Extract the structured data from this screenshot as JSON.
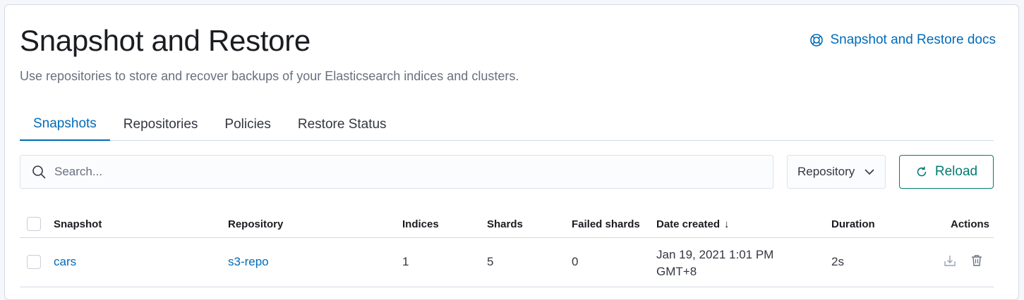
{
  "header": {
    "title": "Snapshot and Restore",
    "subtitle": "Use repositories to store and recover backups of your Elasticsearch indices and clusters.",
    "docs_link": "Snapshot and Restore docs"
  },
  "tabs": [
    {
      "label": "Snapshots",
      "active": true
    },
    {
      "label": "Repositories",
      "active": false
    },
    {
      "label": "Policies",
      "active": false
    },
    {
      "label": "Restore Status",
      "active": false
    }
  ],
  "toolbar": {
    "search_placeholder": "Search...",
    "search_icon": "search-icon",
    "repository_filter": "Repository",
    "reload_label": "Reload"
  },
  "table": {
    "columns": [
      "Snapshot",
      "Repository",
      "Indices",
      "Shards",
      "Failed shards",
      "Date created",
      "Duration",
      "Actions"
    ],
    "sort_indicator": "↓",
    "rows": [
      {
        "snapshot": "cars",
        "repository": "s3-repo",
        "indices": "1",
        "shards": "5",
        "failed_shards": "0",
        "date_created": "Jan 19, 2021 1:01 PM GMT+8",
        "duration": "2s",
        "actions": [
          "restore-icon",
          "delete-icon"
        ]
      }
    ]
  },
  "colors": {
    "link": "#006bb8",
    "reload": "#017d73",
    "border": "#d3dae6"
  }
}
